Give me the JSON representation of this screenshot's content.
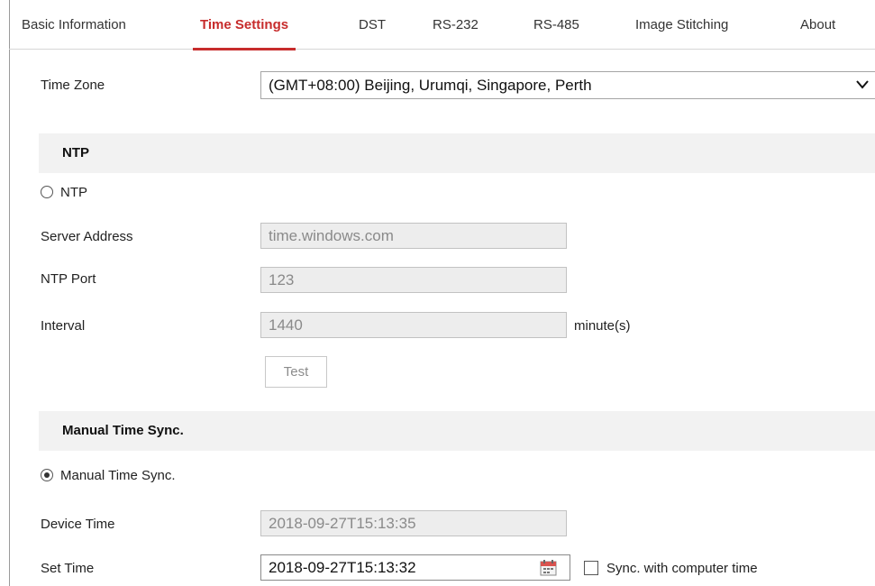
{
  "tabs": [
    {
      "label": "Basic Information",
      "active": false
    },
    {
      "label": "Time Settings",
      "active": true
    },
    {
      "label": "DST",
      "active": false
    },
    {
      "label": "RS-232",
      "active": false
    },
    {
      "label": "RS-485",
      "active": false
    },
    {
      "label": "Image Stitching",
      "active": false
    },
    {
      "label": "About",
      "active": false
    }
  ],
  "time_zone": {
    "label": "Time Zone",
    "selected": "(GMT+08:00) Beijing, Urumqi, Singapore, Perth"
  },
  "ntp": {
    "section_title": "NTP",
    "radio_label": "NTP",
    "radio_checked": false,
    "server_address_label": "Server Address",
    "server_address": "time.windows.com",
    "port_label": "NTP Port",
    "port": "123",
    "interval_label": "Interval",
    "interval": "1440",
    "interval_unit": "minute(s)",
    "test_label": "Test"
  },
  "manual": {
    "section_title": "Manual Time Sync.",
    "radio_label": "Manual Time Sync.",
    "radio_checked": true,
    "device_time_label": "Device Time",
    "device_time": "2018-09-27T15:13:35",
    "set_time_label": "Set Time",
    "set_time": "2018-09-27T15:13:32",
    "calendar_icon": "calendar-icon",
    "sync_label": "Sync. with computer time",
    "sync_checked": false
  },
  "colors": {
    "accent": "#c72c2c",
    "section_bg": "#f2f2f2",
    "disabled_input_bg": "#ededed"
  }
}
